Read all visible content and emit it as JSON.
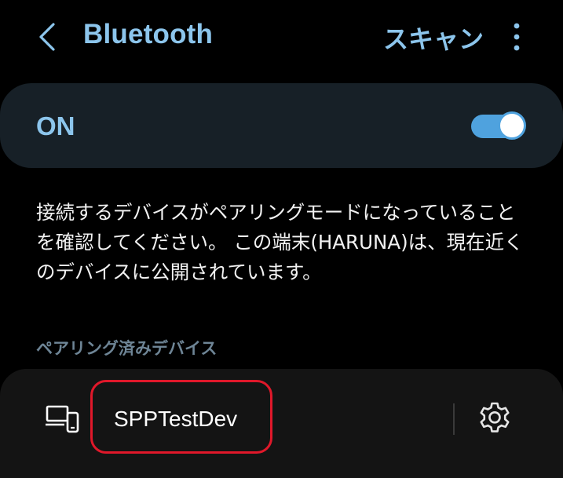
{
  "header": {
    "title": "Bluetooth",
    "scan_label": "スキャン"
  },
  "toggle_card": {
    "label": "ON",
    "enabled": true
  },
  "description": {
    "lines": [
      "接続するデバイスがペアリングモードになっていること",
      "を確認してください。 この端末(HARUNA)は、現在近く",
      "のデバイスに公開されています。"
    ]
  },
  "paired_section": {
    "header": "ペアリング済みデバイス",
    "devices": [
      {
        "name": "SPPTestDev",
        "icon": "devices-icon",
        "settings_icon": "gear-icon"
      }
    ]
  },
  "colors": {
    "accent": "#8cc5ec",
    "toggle": "#4fa2de",
    "card": "#172027",
    "device_card": "#141414",
    "highlight": "#e0182a",
    "section": "#6e8596"
  }
}
